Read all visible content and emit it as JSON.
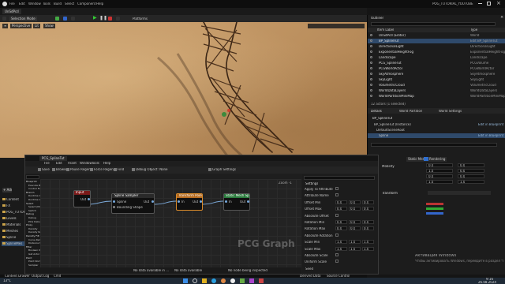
{
  "title_bar": {
    "project_name": "POG_TUTORIAL_YOUTUBE"
  },
  "level_tab": {
    "label": "UnSdPcd"
  },
  "main_toolbar": {
    "mode": "Selection Mode",
    "platforms": "Platforms"
  },
  "viewport": {
    "perspective": "Perspective",
    "lit": "Lit",
    "show": "Show"
  },
  "outliner": {
    "tab": "Outliner",
    "col_label": "Item Label",
    "col_type": "Type",
    "rows": [
      {
        "label": "UnSdPcd (Editor)",
        "type": "World",
        "selected": false
      },
      {
        "label": "BP_SplineTut",
        "type": "Edit BP_SplineTut",
        "selected": true
      },
      {
        "label": "DirectionalLight",
        "type": "DirectionalLight",
        "selected": false
      },
      {
        "label": "ExponentialHeightFog",
        "type": "ExponentialHeightFog",
        "selected": false
      },
      {
        "label": "Landscape",
        "type": "Landscape",
        "selected": false
      },
      {
        "label": "PCG_SplineTut",
        "type": "PCGVolume",
        "selected": false
      },
      {
        "label": "PCGWorldActor",
        "type": "PCGWorldActor",
        "selected": false
      },
      {
        "label": "SkyAtmosphere",
        "type": "SkyAtmosphere",
        "selected": false
      },
      {
        "label": "SkyLight",
        "type": "SkyLight",
        "selected": false
      },
      {
        "label": "VolumetricCloud",
        "type": "VolumetricCloud",
        "selected": false
      },
      {
        "label": "WorldDataLayers",
        "type": "WorldDataLayers",
        "selected": false
      },
      {
        "label": "WorldPartitionMiniMap",
        "type": "WorldPartitionMiniMap",
        "selected": false
      }
    ],
    "count": "12 actors (1 selected)"
  },
  "details": {
    "tabs": [
      "Details",
      "World Partition",
      "World Settings"
    ],
    "actor": "BP_SplineTut",
    "components": [
      {
        "label": "BP_SplineTut (Instance)",
        "badge": "Edit in Blueprint"
      },
      {
        "label": "DefaultSceneRoot",
        "badge": ""
      },
      {
        "label": "Spline",
        "badge": "Edit in Blueprint"
      }
    ]
  },
  "left_panel": {
    "items": [
      "Content",
      "FX",
      "POG_TUTORIAL",
      "Levels",
      "Materials",
      "Meshes",
      "Spline",
      "SplineMes"
    ]
  },
  "pcg_editor": {
    "tab": "PCG_SplineTut",
    "menu": [
      "File",
      "Edit",
      "Asset",
      "Window",
      "Tools",
      "Help"
    ],
    "toolbar": [
      "Save",
      "Browse",
      "Pause Regen",
      "Force Regen",
      "Find",
      "Debug Object: None",
      "Graph Settings"
    ],
    "palette_items": [
      "Blueprint",
      "Execute Blueprint",
      "Control Flow",
      "Branch",
      "Runtime Quality Branch",
      "Runtime Quality Select",
      "Select",
      "Select (Multi)",
      "Switch",
      "Debug",
      "Debug",
      "PCG Debug",
      "Proxy",
      "Density",
      "Density Remap",
      "Density Filter",
      "Curve Remap Density",
      "Distance to Density",
      "Filter",
      "Boolean Density",
      "Get Actor Data",
      "Point",
      "Point Normal",
      "Sampler",
      "Spline Sampler"
    ],
    "search_placeholder": "Search",
    "zoom": "Zoom -1",
    "watermark": "PCG Graph",
    "nodes": {
      "input": {
        "title": "Input",
        "pin": "Out"
      },
      "sampler": {
        "title": "Spline Sampler",
        "pins": [
          "Spline",
          "Bounding Shape",
          "Out"
        ]
      },
      "transform": {
        "title": "Transform Points",
        "pins": [
          "In",
          "Out"
        ]
      },
      "spawner": {
        "title": "Static Mesh Spawner",
        "pins": [
          "In",
          "Out"
        ]
      }
    },
    "bottom": {
      "no_data": "No data available in ...",
      "no_data2": "No data available",
      "inspect": "No node being inspected"
    },
    "details": {
      "search_placeholder": "Search",
      "section": "Settings",
      "props": [
        "Apply To Attribute",
        "Attribute Name",
        "Offset Min",
        "Offset Max",
        "Absolute Offset",
        "Rotation Min",
        "Rotation Max",
        "Absolute Rotation",
        "Scale Min",
        "Scale Max",
        "Absolute Scale",
        "Uniform Scale"
      ],
      "values": {
        "offset_min": [
          "0.0",
          "0.0",
          "0.0"
        ],
        "offset_max": [
          "0.0",
          "0.0",
          "0.0"
        ],
        "rotation_min": [
          "0.0",
          "0.0",
          "0.0"
        ],
        "rotation_max": [
          "0.0",
          "0.0",
          "0.0"
        ],
        "scale_min": [
          "1.0",
          "1.0",
          "1.0"
        ],
        "scale_max": [
          "1.0",
          "1.0",
          "1.0"
        ]
      },
      "footer": "Seed"
    }
  },
  "right_lower": {
    "tabs": [
      "Static Mesh",
      "Rendering"
    ],
    "label_a": "Mobility",
    "values": [
      "0.0",
      "0.0",
      "1.0",
      "0.0",
      "0.0",
      "0.0",
      "1.0",
      "1.0"
    ],
    "section": "Transform",
    "watermark_1": "Активация Windows",
    "watermark_2": "Чтобы активировать Windows, перейдите в раздел \"Параметры\"."
  },
  "status_bar": {
    "content_drawer": "Content Drawer",
    "output_log": "Output Log",
    "cmd": "Cmd",
    "derived": "Derived Data",
    "source": "Source Control"
  },
  "taskbar": {
    "weather": "13°C",
    "time": "9:16",
    "date": "26.08.2024"
  },
  "colors": {
    "select": "#2f4a6b",
    "pcg_node_input": "#7a1a1a",
    "pcg_node_sampler": "#1c1c1c",
    "pcg_node_transform": "#b46a1f",
    "pcg_node_spawner": "#2a7a3c",
    "edge": "#7aa7d6"
  }
}
